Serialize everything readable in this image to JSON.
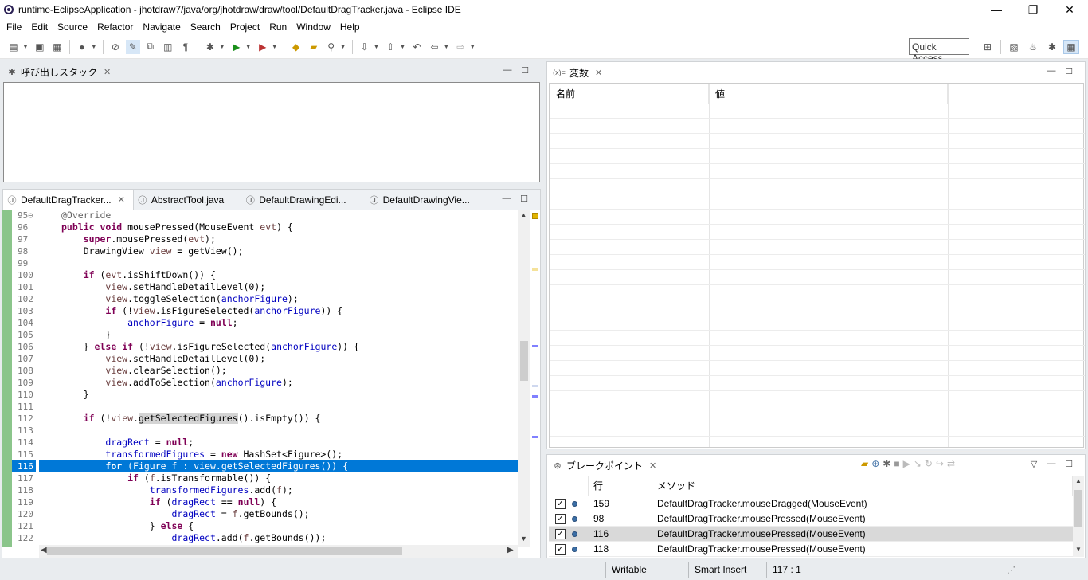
{
  "window": {
    "title": "runtime-EclipseApplication - jhotdraw7/java/org/jhotdraw/draw/tool/DefaultDragTracker.java - Eclipse IDE",
    "minimize": "—",
    "restore": "❐",
    "close": "✕"
  },
  "menu": [
    "File",
    "Edit",
    "Source",
    "Refactor",
    "Navigate",
    "Search",
    "Project",
    "Run",
    "Window",
    "Help"
  ],
  "quick_access": "Quick Access",
  "callstack": {
    "tab": "呼び出しスタック"
  },
  "editor": {
    "tabs": [
      "DefaultDragTracker...",
      "AbstractTool.java",
      "DefaultDrawingEdi...",
      "DefaultDrawingVie..."
    ],
    "line_numbers": [
      "95⊖",
      "96",
      "97",
      "98",
      "99",
      "100",
      "101",
      "102",
      "103",
      "104",
      "105",
      "106",
      "107",
      "108",
      "109",
      "110",
      "111",
      "112",
      "113",
      "114",
      "115",
      "116",
      "117",
      "118",
      "119",
      "120",
      "121",
      "122"
    ]
  },
  "variables": {
    "tab": "変数",
    "col_name": "名前",
    "col_value": "値"
  },
  "breakpoints": {
    "tab": "ブレークポイント",
    "col_line": "行",
    "col_method": "メソッド",
    "rows": [
      {
        "line": "159",
        "method": "DefaultDragTracker.mouseDragged(MouseEvent)",
        "checked": "✓"
      },
      {
        "line": "98",
        "method": "DefaultDragTracker.mousePressed(MouseEvent)",
        "checked": "✓"
      },
      {
        "line": "116",
        "method": "DefaultDragTracker.mousePressed(MouseEvent)",
        "checked": "✓"
      },
      {
        "line": "118",
        "method": "DefaultDragTracker.mousePressed(MouseEvent)",
        "checked": "✓"
      }
    ]
  },
  "status": {
    "writable": "Writable",
    "insert": "Smart Insert",
    "position": "117 : 1"
  },
  "colors": {
    "selection": "#0078d7",
    "gutter": "#8bc58b",
    "keyword": "#7f0055",
    "field": "#0000c0"
  }
}
